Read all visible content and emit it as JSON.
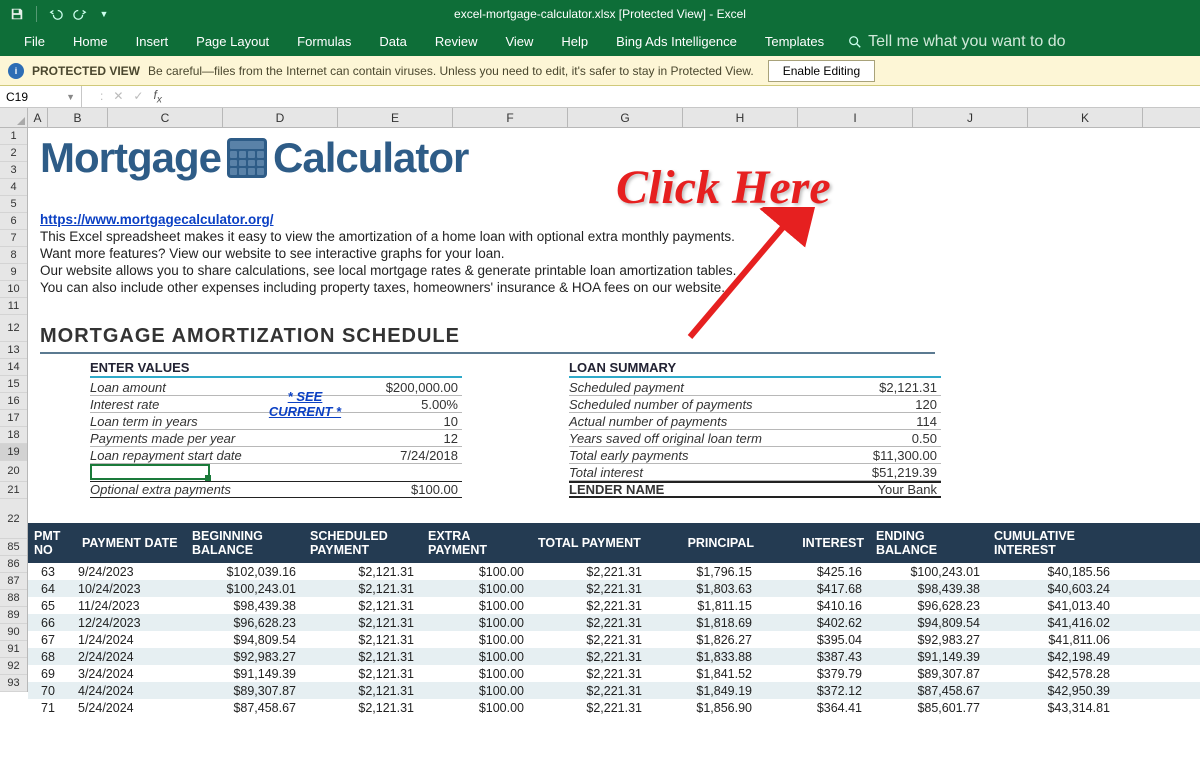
{
  "window": {
    "title": "excel-mortgage-calculator.xlsx  [Protected View]  -  Excel"
  },
  "ribbon": {
    "tabs": [
      "File",
      "Home",
      "Insert",
      "Page Layout",
      "Formulas",
      "Data",
      "Review",
      "View",
      "Help",
      "Bing Ads Intelligence",
      "Templates"
    ],
    "search_placeholder": "Tell me what you want to do"
  },
  "protected_view": {
    "title": "PROTECTED VIEW",
    "message": "Be careful—files from the Internet can contain viruses. Unless you need to edit, it's safer to stay in Protected View.",
    "button": "Enable Editing"
  },
  "name_box": "C19",
  "columns": [
    "A",
    "B",
    "C",
    "D",
    "E",
    "F",
    "G",
    "H",
    "I",
    "J",
    "K"
  ],
  "row_numbers_top": [
    "1",
    "2",
    "3",
    "4",
    "5",
    "6",
    "7",
    "8",
    "9",
    "10",
    "11",
    "12",
    "13",
    "14",
    "15",
    "16",
    "17",
    "18",
    "19",
    "20",
    "21",
    "22"
  ],
  "row_numbers_data": [
    "85",
    "86",
    "87",
    "88",
    "89",
    "90",
    "91",
    "92",
    "93"
  ],
  "logo": {
    "part1": "Mortgage",
    "part2": "Calculator"
  },
  "intro": {
    "link": "https://www.mortgagecalculator.org/",
    "lines": [
      "This Excel spreadsheet makes it easy to view the amortization of a home loan with optional extra monthly payments.",
      "Want more features? View our website to see interactive graphs for your loan.",
      "Our website allows you to share calculations, see local mortgage rates & generate printable loan amortization tables.",
      "You can also include other expenses including property taxes, homeowners' insurance & HOA fees on our website."
    ]
  },
  "section_title": "MORTGAGE AMORTIZATION SCHEDULE",
  "enter_values": {
    "title": "ENTER VALUES",
    "rows": [
      {
        "label": "Loan amount",
        "mid": "",
        "val": "$200,000.00"
      },
      {
        "label": "Interest rate",
        "mid": "* SEE CURRENT *",
        "val": "5.00%"
      },
      {
        "label": "Loan term in years",
        "mid": "",
        "val": "10"
      },
      {
        "label": "Payments made per year",
        "mid": "",
        "val": "12"
      },
      {
        "label": "Loan repayment start date",
        "mid": "",
        "val": "7/24/2018"
      }
    ],
    "optional": {
      "label": "Optional extra payments",
      "val": "$100.00"
    }
  },
  "loan_summary": {
    "title": "LOAN SUMMARY",
    "rows": [
      {
        "label": "Scheduled payment",
        "val": "$2,121.31"
      },
      {
        "label": "Scheduled number of payments",
        "val": "120"
      },
      {
        "label": "Actual number of payments",
        "val": "114"
      },
      {
        "label": "Years saved off original loan term",
        "val": "0.50"
      },
      {
        "label": "Total early payments",
        "val": "$11,300.00"
      },
      {
        "label": "Total interest",
        "val": "$51,219.39"
      }
    ],
    "lender": {
      "label": "LENDER NAME",
      "val": "Your Bank"
    }
  },
  "amort": {
    "headers": {
      "no": "PMT NO",
      "date": "PAYMENT DATE",
      "beg": "BEGINNING BALANCE",
      "sched": "SCHEDULED PAYMENT",
      "extra": "EXTRA PAYMENT",
      "total": "TOTAL PAYMENT",
      "princ": "PRINCIPAL",
      "int": "INTEREST",
      "end": "ENDING BALANCE",
      "cum": "CUMULATIVE INTEREST"
    },
    "rows": [
      {
        "no": "63",
        "date": "9/24/2023",
        "beg": "$102,039.16",
        "sched": "$2,121.31",
        "extra": "$100.00",
        "total": "$2,221.31",
        "princ": "$1,796.15",
        "int": "$425.16",
        "end": "$100,243.01",
        "cum": "$40,185.56"
      },
      {
        "no": "64",
        "date": "10/24/2023",
        "beg": "$100,243.01",
        "sched": "$2,121.31",
        "extra": "$100.00",
        "total": "$2,221.31",
        "princ": "$1,803.63",
        "int": "$417.68",
        "end": "$98,439.38",
        "cum": "$40,603.24"
      },
      {
        "no": "65",
        "date": "11/24/2023",
        "beg": "$98,439.38",
        "sched": "$2,121.31",
        "extra": "$100.00",
        "total": "$2,221.31",
        "princ": "$1,811.15",
        "int": "$410.16",
        "end": "$96,628.23",
        "cum": "$41,013.40"
      },
      {
        "no": "66",
        "date": "12/24/2023",
        "beg": "$96,628.23",
        "sched": "$2,121.31",
        "extra": "$100.00",
        "total": "$2,221.31",
        "princ": "$1,818.69",
        "int": "$402.62",
        "end": "$94,809.54",
        "cum": "$41,416.02"
      },
      {
        "no": "67",
        "date": "1/24/2024",
        "beg": "$94,809.54",
        "sched": "$2,121.31",
        "extra": "$100.00",
        "total": "$2,221.31",
        "princ": "$1,826.27",
        "int": "$395.04",
        "end": "$92,983.27",
        "cum": "$41,811.06"
      },
      {
        "no": "68",
        "date": "2/24/2024",
        "beg": "$92,983.27",
        "sched": "$2,121.31",
        "extra": "$100.00",
        "total": "$2,221.31",
        "princ": "$1,833.88",
        "int": "$387.43",
        "end": "$91,149.39",
        "cum": "$42,198.49"
      },
      {
        "no": "69",
        "date": "3/24/2024",
        "beg": "$91,149.39",
        "sched": "$2,121.31",
        "extra": "$100.00",
        "total": "$2,221.31",
        "princ": "$1,841.52",
        "int": "$379.79",
        "end": "$89,307.87",
        "cum": "$42,578.28"
      },
      {
        "no": "70",
        "date": "4/24/2024",
        "beg": "$89,307.87",
        "sched": "$2,121.31",
        "extra": "$100.00",
        "total": "$2,221.31",
        "princ": "$1,849.19",
        "int": "$372.12",
        "end": "$87,458.67",
        "cum": "$42,950.39"
      },
      {
        "no": "71",
        "date": "5/24/2024",
        "beg": "$87,458.67",
        "sched": "$2,121.31",
        "extra": "$100.00",
        "total": "$2,221.31",
        "princ": "$1,856.90",
        "int": "$364.41",
        "end": "$85,601.77",
        "cum": "$43,314.81"
      }
    ]
  },
  "annotation": {
    "text": "Click Here"
  }
}
